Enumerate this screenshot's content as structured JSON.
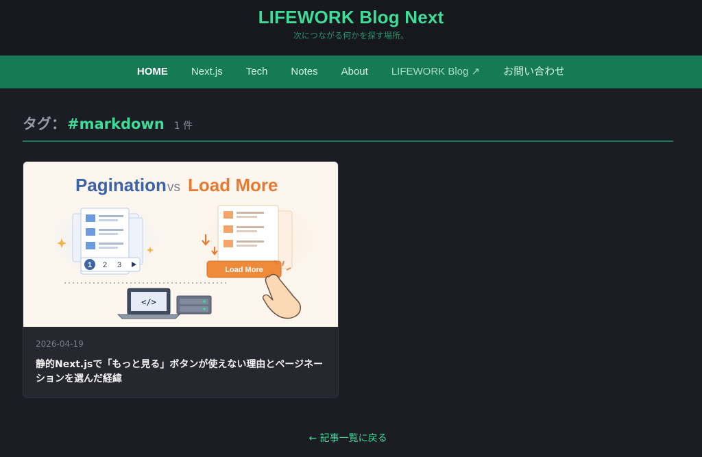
{
  "header": {
    "title": "LIFEWORK Blog Next",
    "tagline": "次につながる何かを探す場所。"
  },
  "nav": {
    "items": [
      {
        "label": "HOME"
      },
      {
        "label": "Next.js"
      },
      {
        "label": "Tech"
      },
      {
        "label": "Notes"
      },
      {
        "label": "About"
      },
      {
        "label": "LIFEWORK Blog ↗"
      },
      {
        "label": "お問い合わせ"
      }
    ]
  },
  "tag_page": {
    "prefix": "タグ：",
    "tag": "#markdown",
    "count": "1 件"
  },
  "posts": [
    {
      "date": "2026-04-19",
      "title": "静的Next.jsで「もっと見る」ボタンが使えない理由とページネーションを選んだ経緯",
      "thumbnail": {
        "heading_left": "Pagination",
        "heading_vs": "vs",
        "heading_right": "Load More",
        "pages": [
          "1",
          "2",
          "3"
        ],
        "button": "Load More",
        "code": "</>"
      }
    }
  ],
  "footer": {
    "back_link": "← 記事一覧に戻る"
  },
  "colors": {
    "accent": "#3ddc97",
    "nav_bg": "#157a55",
    "page_bg": "#1c1c24",
    "card_bg": "#26272f"
  }
}
